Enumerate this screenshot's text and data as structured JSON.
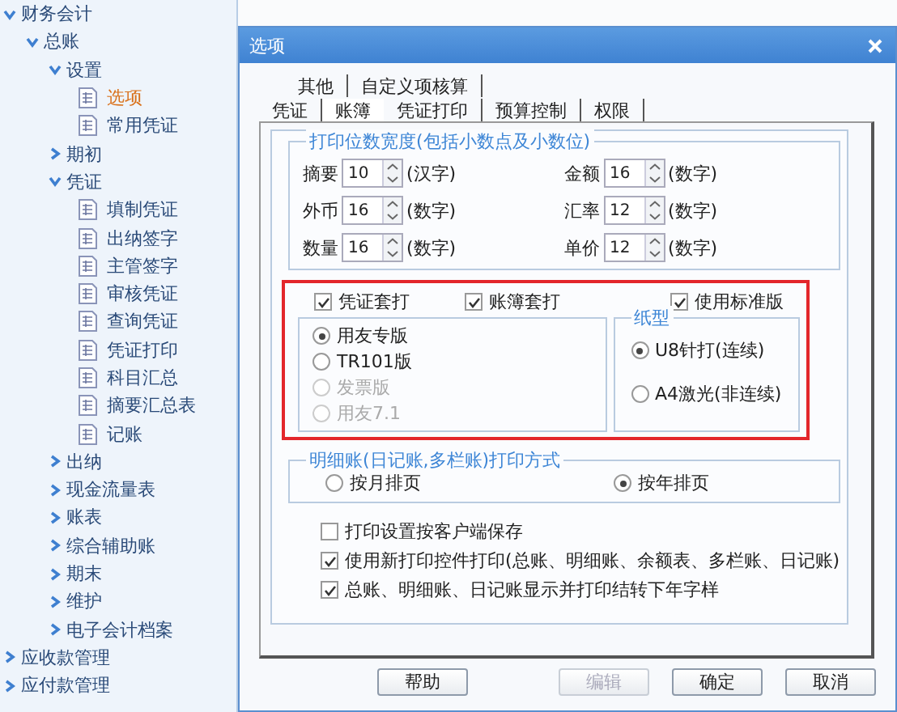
{
  "tree": [
    {
      "label": "财务会计",
      "kind": "folder",
      "expanded": true,
      "selected": false,
      "children": [
        {
          "label": "总账",
          "kind": "folder",
          "expanded": true,
          "selected": false,
          "children": [
            {
              "label": "设置",
              "kind": "folder",
              "expanded": true,
              "selected": false,
              "children": [
                {
                  "label": "选项",
                  "kind": "leaf",
                  "selected": true
                },
                {
                  "label": "常用凭证",
                  "kind": "leaf",
                  "selected": false
                }
              ]
            },
            {
              "label": "期初",
              "kind": "folder",
              "expanded": false,
              "selected": false
            },
            {
              "label": "凭证",
              "kind": "folder",
              "expanded": true,
              "selected": false,
              "children": [
                {
                  "label": "填制凭证",
                  "kind": "leaf",
                  "selected": false
                },
                {
                  "label": "出纳签字",
                  "kind": "leaf",
                  "selected": false
                },
                {
                  "label": "主管签字",
                  "kind": "leaf",
                  "selected": false
                },
                {
                  "label": "审核凭证",
                  "kind": "leaf",
                  "selected": false
                },
                {
                  "label": "查询凭证",
                  "kind": "leaf",
                  "selected": false
                },
                {
                  "label": "凭证打印",
                  "kind": "leaf",
                  "selected": false
                },
                {
                  "label": "科目汇总",
                  "kind": "leaf",
                  "selected": false
                },
                {
                  "label": "摘要汇总表",
                  "kind": "leaf",
                  "selected": false
                },
                {
                  "label": "记账",
                  "kind": "leaf",
                  "selected": false
                }
              ]
            },
            {
              "label": "出纳",
              "kind": "folder",
              "expanded": false,
              "selected": false
            },
            {
              "label": "现金流量表",
              "kind": "folder",
              "expanded": false,
              "selected": false
            },
            {
              "label": "账表",
              "kind": "folder",
              "expanded": false,
              "selected": false
            },
            {
              "label": "综合辅助账",
              "kind": "folder",
              "expanded": false,
              "selected": false
            },
            {
              "label": "期末",
              "kind": "folder",
              "expanded": false,
              "selected": false
            },
            {
              "label": "维护",
              "kind": "folder",
              "expanded": false,
              "selected": false
            },
            {
              "label": "电子会计档案",
              "kind": "folder",
              "expanded": false,
              "selected": false
            }
          ]
        }
      ]
    },
    {
      "label": "应收款管理",
      "kind": "folder",
      "expanded": false,
      "selected": false
    },
    {
      "label": "应付款管理",
      "kind": "folder",
      "expanded": false,
      "selected": false
    }
  ],
  "dialog": {
    "title": "选项",
    "tab_rows": [
      [
        {
          "label": "其他",
          "selected": false
        },
        {
          "label": "自定义项核算",
          "selected": false
        }
      ],
      [
        {
          "label": "凭证",
          "selected": false
        },
        {
          "label": "账簿",
          "selected": true
        },
        {
          "label": "凭证打印",
          "selected": false
        },
        {
          "label": "预算控制",
          "selected": false
        },
        {
          "label": "权限",
          "selected": false
        }
      ]
    ],
    "width_group": {
      "title": "打印位数宽度(包括小数点及小数位)",
      "fields": [
        {
          "label": "摘要",
          "value": "10",
          "unit": "(汉字)"
        },
        {
          "label": "金额",
          "value": "16",
          "unit": "(数字)"
        },
        {
          "label": "外币",
          "value": "16",
          "unit": "(数字)"
        },
        {
          "label": "汇率",
          "value": "12",
          "unit": "(数字)"
        },
        {
          "label": "数量",
          "value": "16",
          "unit": "(数字)"
        },
        {
          "label": "单价",
          "value": "12",
          "unit": "(数字)"
        }
      ]
    },
    "print_group": {
      "highlighted": true,
      "checkboxes": [
        {
          "label": "凭证套打",
          "checked": true
        },
        {
          "label": "账簿套打",
          "checked": true
        },
        {
          "label": "使用标准版",
          "checked": true
        }
      ],
      "format_radios": [
        {
          "label": "用友专版",
          "selected": true,
          "disabled": false
        },
        {
          "label": "TR101版",
          "selected": false,
          "disabled": false
        },
        {
          "label": "发票版",
          "selected": false,
          "disabled": true
        },
        {
          "label": "用友7.1",
          "selected": false,
          "disabled": true
        }
      ],
      "paper_group": {
        "title": "纸型",
        "radios": [
          {
            "label": "U8针打(连续)",
            "selected": true
          },
          {
            "label": "A4激光(非连续)",
            "selected": false
          }
        ]
      }
    },
    "ledger_group": {
      "title": "明细账(日记账,多栏账)打印方式",
      "radios": [
        {
          "label": "按月排页",
          "selected": false
        },
        {
          "label": "按年排页",
          "selected": true
        }
      ]
    },
    "options": [
      {
        "label": "打印设置按客户端保存",
        "checked": false
      },
      {
        "label": "使用新打印控件打印(总账、明细账、余额表、多栏账、日记账)",
        "checked": true
      },
      {
        "label": "总账、明细账、日记账显示并打印结转下年字样",
        "checked": true
      }
    ],
    "buttons": [
      {
        "label": "帮助",
        "disabled": false
      },
      {
        "label": "编辑",
        "disabled": true
      },
      {
        "label": "确定",
        "disabled": false
      },
      {
        "label": "取消",
        "disabled": false
      }
    ]
  }
}
